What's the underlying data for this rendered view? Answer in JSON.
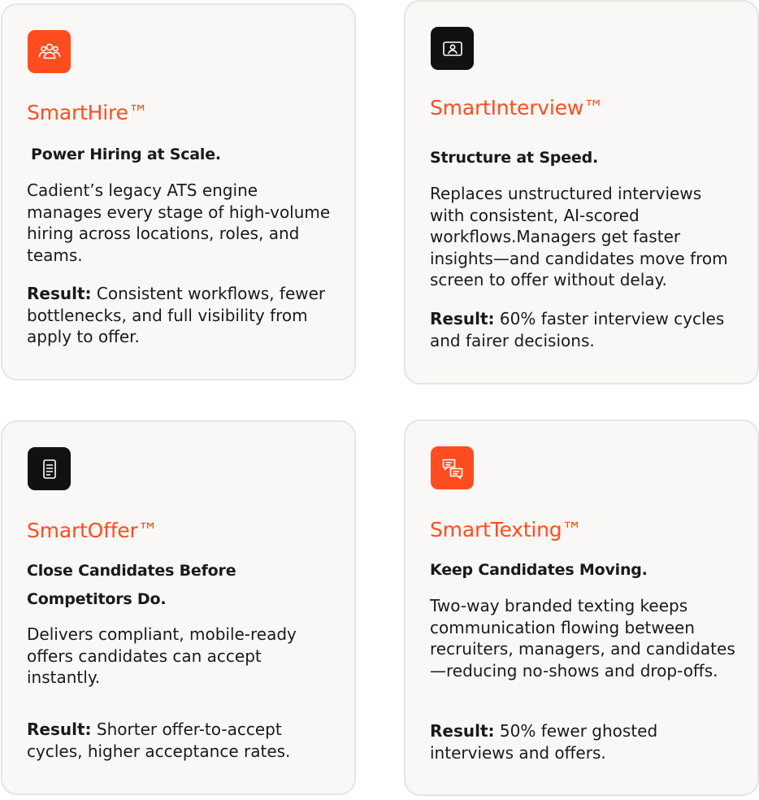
{
  "colors": {
    "accent": "#ff4d1f",
    "dark": "#111111",
    "card_bg": "#f9f8f6",
    "card_border": "#e6e5e2"
  },
  "cards": [
    {
      "icon": "people-group-icon",
      "title": "SmartHire™",
      "subtitle": "Power Hiring at Scale.",
      "description": "Cadient’s legacy ATS engine manages every stage of high-volume hiring across locations, roles, and teams.",
      "result_label": "Result:",
      "result_text": "Consistent workflows, fewer bottlenecks, and full visibility from apply to offer."
    },
    {
      "icon": "video-interview-icon",
      "title": "SmartInterview™",
      "subtitle": "Structure at Speed.",
      "description": "Replaces unstructured interviews with consistent, AI-scored workflows.Managers get faster insights—and candidates move from screen to offer without delay.",
      "result_label": "Result:",
      "result_text": "60% faster interview cycles and fairer decisions."
    },
    {
      "icon": "document-icon",
      "title": "SmartOffer™",
      "subtitle_line1": "Close Candidates Before",
      "subtitle_line2": "Competitors Do.",
      "description": "Delivers compliant, mobile-ready offers candidates can accept instantly.",
      "result_label": "Result:",
      "result_text": "Shorter offer-to-accept cycles, higher acceptance rates."
    },
    {
      "icon": "chat-bubbles-icon",
      "title": "SmartTexting™",
      "subtitle": "Keep Candidates Moving.",
      "description": "Two-way branded texting keeps communication flowing between recruiters, managers, and candidates—reducing no-shows and drop-offs.",
      "result_label": "Result:",
      "result_text": "50% fewer ghosted interviews and offers."
    }
  ]
}
